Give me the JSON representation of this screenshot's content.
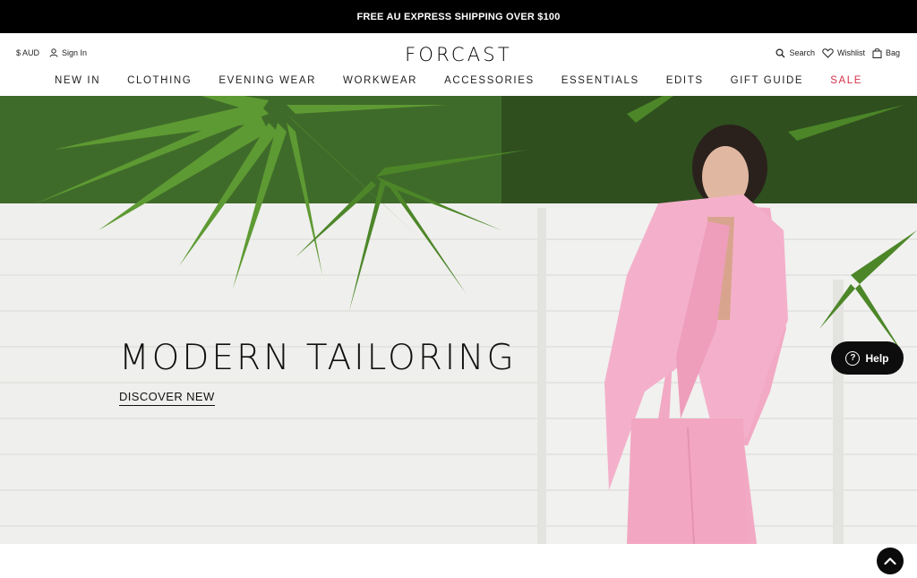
{
  "announcement": "FREE AU EXPRESS SHIPPING OVER $100",
  "header": {
    "currency": "$ AUD",
    "sign_in": "Sign In",
    "logo": "FORCAST",
    "search": "Search",
    "wishlist": "Wishlist",
    "bag": "Bag"
  },
  "nav": [
    "NEW IN",
    "CLOTHING",
    "EVENING WEAR",
    "WORKWEAR",
    "ACCESSORIES",
    "ESSENTIALS",
    "EDITS",
    "GIFT GUIDE",
    "SALE"
  ],
  "hero": {
    "title": "MODERN TAILORING",
    "cta": "DISCOVER NEW"
  },
  "help": "Help",
  "colors": {
    "sale": "#d6324a",
    "suit": "#f2a9c4",
    "foliage": "#4f8a2c",
    "wall": "#efefed"
  }
}
